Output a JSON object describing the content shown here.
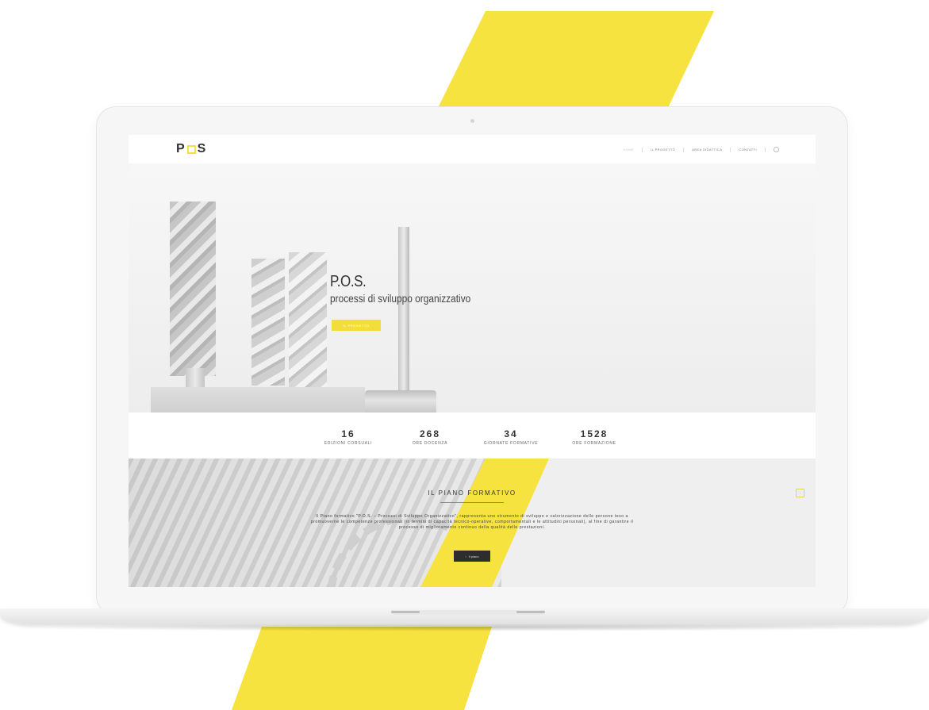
{
  "colors": {
    "accent_yellow": "#f6e33f",
    "dark_button": "#2d2d2d"
  },
  "nav": {
    "logo": {
      "left": "P",
      "right": "S"
    },
    "menu": [
      {
        "label": "HOME",
        "active": true
      },
      {
        "label": "IL PROGETTO"
      },
      {
        "label": "AREA DIDATTICA"
      },
      {
        "label": "CONTATTI"
      }
    ],
    "search_icon": "search-icon"
  },
  "hero": {
    "title": "P.O.S.",
    "subtitle": "processi di sviluppo organizzativo",
    "button_label": "IL PROGETTO"
  },
  "stats": [
    {
      "value": "16",
      "label": "EDIZIONI CORSUALI"
    },
    {
      "value": "268",
      "label": "ORE DOCENZA"
    },
    {
      "value": "34",
      "label": "GIORNATE FORMATIVE"
    },
    {
      "value": "1528",
      "label": "ORE FORMAZIONE"
    }
  ],
  "piano": {
    "title": "IL PIANO FORMATIVO",
    "text": "Il Piano formativo \"P.O.S. – Processi di Sviluppo Organizzativo\", rappresenta uno strumento di sviluppo e valorizzazione delle persone teso a promuoverne le competenze professionali (in termini di capacità tecnico-operative, comportamentali e le attitudini personali), al fine di garantire il processo di miglioramento continuo della qualità delle prestazioni.",
    "button_label": "Il piano",
    "button_icon": "chevron-right-icon",
    "side_icon": "chevron-right-icon"
  }
}
